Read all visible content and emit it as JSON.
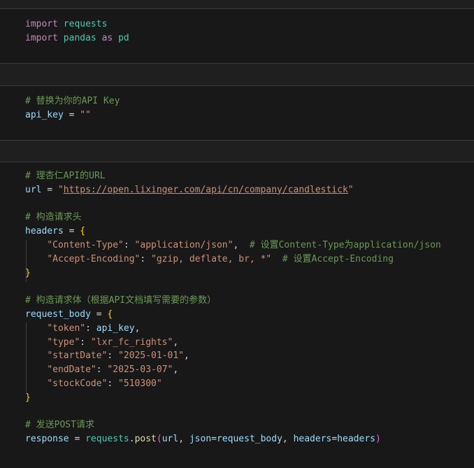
{
  "cells": [
    {
      "lines": [
        [
          {
            "t": "import",
            "c": "kw"
          },
          {
            "t": " ",
            "c": "op"
          },
          {
            "t": "requests",
            "c": "mod"
          }
        ],
        [
          {
            "t": "import",
            "c": "kw"
          },
          {
            "t": " ",
            "c": "op"
          },
          {
            "t": "pandas",
            "c": "mod"
          },
          {
            "t": " ",
            "c": "op"
          },
          {
            "t": "as",
            "c": "kw"
          },
          {
            "t": " ",
            "c": "op"
          },
          {
            "t": "pd",
            "c": "mod"
          }
        ]
      ]
    },
    {
      "lines": [
        [
          {
            "t": "# 替换为你的API Key",
            "c": "cmt"
          }
        ],
        [
          {
            "t": "api_key",
            "c": "var"
          },
          {
            "t": " = ",
            "c": "op"
          },
          {
            "t": "\"\"",
            "c": "str"
          }
        ]
      ]
    },
    {
      "lines": [
        [
          {
            "t": "# 理杏仁API的URL",
            "c": "cmt"
          }
        ],
        [
          {
            "t": "url",
            "c": "var"
          },
          {
            "t": " = ",
            "c": "op"
          },
          {
            "t": "\"",
            "c": "str"
          },
          {
            "t": "https://open.lixinger.com/api/cn/company/candlestick",
            "c": "url"
          },
          {
            "t": "\"",
            "c": "str"
          }
        ],
        [],
        [
          {
            "t": "# 构造请求头",
            "c": "cmt"
          }
        ],
        [
          {
            "t": "headers",
            "c": "var"
          },
          {
            "t": " = ",
            "c": "op"
          },
          {
            "t": "{",
            "c": "brace"
          }
        ],
        [
          {
            "t": "    ",
            "c": "op"
          },
          {
            "t": "\"Content-Type\"",
            "c": "str"
          },
          {
            "t": ": ",
            "c": "op"
          },
          {
            "t": "\"application/json\"",
            "c": "str"
          },
          {
            "t": ",  ",
            "c": "op"
          },
          {
            "t": "# 设置Content-Type为application/json",
            "c": "cmt"
          }
        ],
        [
          {
            "t": "    ",
            "c": "op"
          },
          {
            "t": "\"Accept-Encoding\"",
            "c": "str"
          },
          {
            "t": ": ",
            "c": "op"
          },
          {
            "t": "\"gzip, deflate, br, *\"",
            "c": "str"
          },
          {
            "t": "  ",
            "c": "op"
          },
          {
            "t": "# 设置Accept-Encoding",
            "c": "cmt"
          }
        ],
        [
          {
            "t": "}",
            "c": "brace"
          }
        ],
        [],
        [
          {
            "t": "# 构造请求体（根据API文档填写需要的参数）",
            "c": "cmt"
          }
        ],
        [
          {
            "t": "request_body",
            "c": "var"
          },
          {
            "t": " = ",
            "c": "op"
          },
          {
            "t": "{",
            "c": "brace"
          }
        ],
        [
          {
            "t": "    ",
            "c": "op"
          },
          {
            "t": "\"token\"",
            "c": "str"
          },
          {
            "t": ": ",
            "c": "op"
          },
          {
            "t": "api_key",
            "c": "var"
          },
          {
            "t": ",",
            "c": "op"
          }
        ],
        [
          {
            "t": "    ",
            "c": "op"
          },
          {
            "t": "\"type\"",
            "c": "str"
          },
          {
            "t": ": ",
            "c": "op"
          },
          {
            "t": "\"lxr_fc_rights\"",
            "c": "str"
          },
          {
            "t": ",",
            "c": "op"
          }
        ],
        [
          {
            "t": "    ",
            "c": "op"
          },
          {
            "t": "\"startDate\"",
            "c": "str"
          },
          {
            "t": ": ",
            "c": "op"
          },
          {
            "t": "\"2025-01-01\"",
            "c": "str"
          },
          {
            "t": ",",
            "c": "op"
          }
        ],
        [
          {
            "t": "    ",
            "c": "op"
          },
          {
            "t": "\"endDate\"",
            "c": "str"
          },
          {
            "t": ": ",
            "c": "op"
          },
          {
            "t": "\"2025-03-07\"",
            "c": "str"
          },
          {
            "t": ",",
            "c": "op"
          }
        ],
        [
          {
            "t": "    ",
            "c": "op"
          },
          {
            "t": "\"stockCode\"",
            "c": "str"
          },
          {
            "t": ": ",
            "c": "op"
          },
          {
            "t": "\"510300\"",
            "c": "str"
          }
        ],
        [
          {
            "t": "}",
            "c": "brace"
          }
        ],
        [],
        [
          {
            "t": "# 发送POST请求",
            "c": "cmt"
          }
        ],
        [
          {
            "t": "response",
            "c": "var"
          },
          {
            "t": " = ",
            "c": "op"
          },
          {
            "t": "requests",
            "c": "mod"
          },
          {
            "t": ".",
            "c": "op"
          },
          {
            "t": "post",
            "c": "fn"
          },
          {
            "t": "(",
            "c": "paren"
          },
          {
            "t": "url",
            "c": "var"
          },
          {
            "t": ", ",
            "c": "op"
          },
          {
            "t": "json",
            "c": "var"
          },
          {
            "t": "=",
            "c": "op"
          },
          {
            "t": "request_body",
            "c": "var"
          },
          {
            "t": ", ",
            "c": "op"
          },
          {
            "t": "headers",
            "c": "var"
          },
          {
            "t": "=",
            "c": "op"
          },
          {
            "t": "headers",
            "c": "var"
          },
          {
            "t": ")",
            "c": "paren"
          }
        ]
      ]
    }
  ]
}
